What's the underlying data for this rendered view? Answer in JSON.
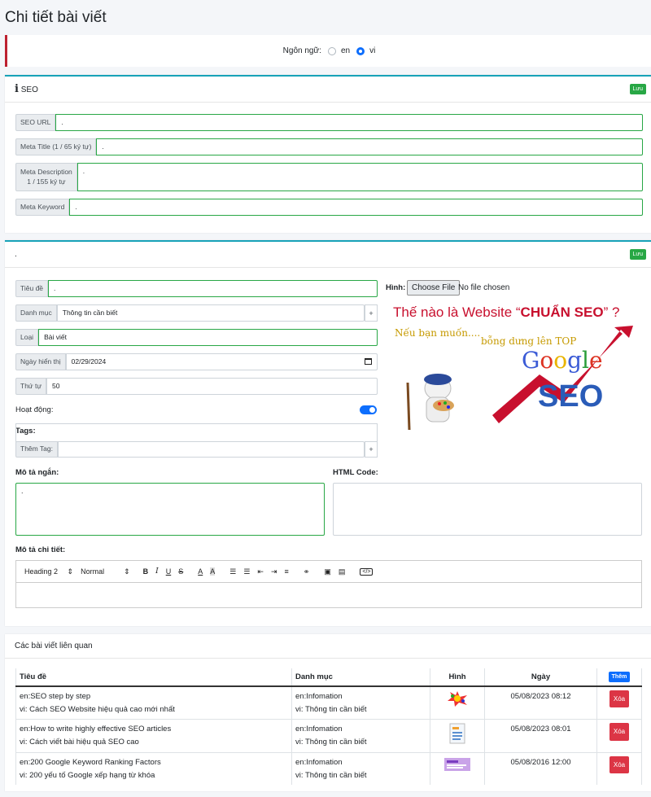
{
  "page": {
    "title": "Chi tiết bài viết"
  },
  "language": {
    "label": "Ngôn ngữ:",
    "options": [
      "en",
      "vi"
    ],
    "selected": "vi"
  },
  "seo": {
    "header": "SEO",
    "save": "Lưu",
    "url_label": "SEO URL",
    "url_value": ".",
    "meta_title_label": "Meta Title (1 / 65 ký tự)",
    "meta_title_value": ".",
    "meta_desc_label_1": "Meta Description",
    "meta_desc_label_2": "1 / 155 ký tự",
    "meta_desc_value": ".",
    "meta_kw_label": "Meta Keyword",
    "meta_kw_value": "."
  },
  "detail": {
    "header": ".",
    "save": "Lưu",
    "title_label": "Tiêu đề",
    "title_value": ".",
    "category_label": "Danh mục",
    "category_value": "Thông tin cần biết",
    "type_label": "Loại",
    "type_value": "Bài viết",
    "date_label": "Ngày hiển thị",
    "date_value": "02/29/2024",
    "order_label": "Thứ tự",
    "order_value": "50",
    "active_label": "Hoạt động:",
    "active": true,
    "tags_label": "Tags:",
    "add_tag_label": "Thêm Tag:",
    "image_label": "Hình:",
    "choose_file": "Choose File",
    "no_file": "No file chosen",
    "short_desc_label": "Mô tả ngắn:",
    "short_desc_value": ".",
    "html_code_label": "HTML Code:",
    "long_desc_label": "Mô tả chi tiết:",
    "editor": {
      "heading": "Heading 2",
      "size": "Normal"
    },
    "banner": {
      "headline_1": "Thế nào là Website “",
      "headline_2": "CHUẨN SEO",
      "headline_3": "” ?",
      "line_1": "Nếu bạn muốn....",
      "line_2": "bỗng dưng lên TOP",
      "google": [
        "G",
        "o",
        "o",
        "g",
        "l",
        "e"
      ],
      "seo": "SEO"
    }
  },
  "related": {
    "header": "Các bài viết liên quan",
    "columns": [
      "Tiêu đề",
      "Danh mục",
      "Hình",
      "Ngày"
    ],
    "add": "Thêm",
    "delete": "Xóa",
    "rows": [
      {
        "title_en": "en:SEO step by step",
        "title_vi": "vi:  Cách SEO Website hiệu quả cao mới nhất",
        "cat_en": "en:Infomation",
        "cat_vi": "vi:  Thông tin cần biết",
        "date": "05/08/2023 08:12"
      },
      {
        "title_en": "en:How to write highly effective SEO articles",
        "title_vi": "vi:  Cách viết bài hiệu quả SEO cao",
        "cat_en": "en:Infomation",
        "cat_vi": "vi:  Thông tin cần biết",
        "date": "05/08/2023 08:01"
      },
      {
        "title_en": "en:200 Google Keyword Ranking Factors",
        "title_vi": "vi:  200 yếu tố Google xếp hạng từ khóa",
        "cat_en": "en:Infomation",
        "cat_vi": "vi:  Thông tin cần biết",
        "date": "05/08/2016 12:00"
      }
    ]
  }
}
